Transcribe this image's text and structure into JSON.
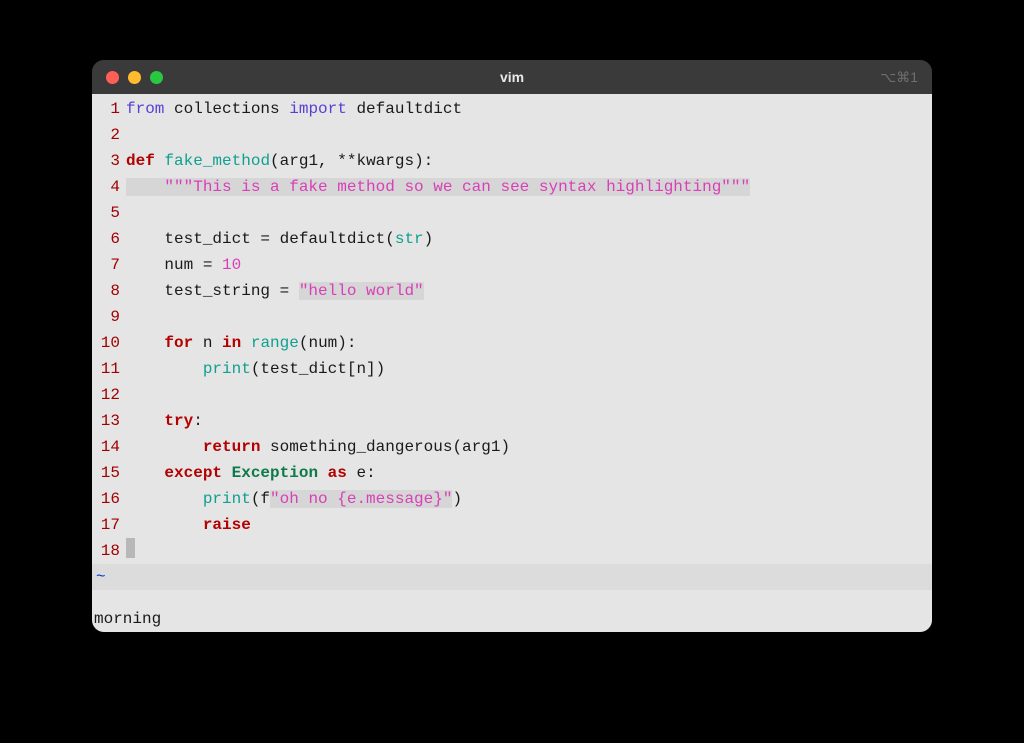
{
  "window": {
    "title": "vim",
    "shortcut": "⌥⌘1"
  },
  "traffic": {
    "red": "#ff5f57",
    "yellow": "#febc2e",
    "green": "#28c840"
  },
  "lines": [
    {
      "n": "1",
      "tokens": [
        [
          "keyword",
          "from"
        ],
        [
          "default",
          " collections "
        ],
        [
          "keyword",
          "import"
        ],
        [
          "default",
          " defaultdict"
        ]
      ]
    },
    {
      "n": "2",
      "tokens": []
    },
    {
      "n": "3",
      "tokens": [
        [
          "kw2",
          "def"
        ],
        [
          "default",
          " "
        ],
        [
          "func",
          "fake_method"
        ],
        [
          "default",
          "(arg1, **kwargs):"
        ]
      ]
    },
    {
      "n": "4",
      "tokens": [
        [
          "default",
          "    "
        ],
        [
          "string",
          "\"\"\"This is a fake method so we can see syntax highlighting\"\"\""
        ]
      ],
      "hlbg": true
    },
    {
      "n": "5",
      "tokens": []
    },
    {
      "n": "6",
      "tokens": [
        [
          "default",
          "    test_dict = defaultdict("
        ],
        [
          "type",
          "str"
        ],
        [
          "default",
          ")"
        ]
      ]
    },
    {
      "n": "7",
      "tokens": [
        [
          "default",
          "    num = "
        ],
        [
          "number",
          "10"
        ]
      ]
    },
    {
      "n": "8",
      "tokens": [
        [
          "default",
          "    test_string = "
        ],
        [
          "string",
          "\"hello world\""
        ]
      ],
      "hlbg_tokens": true
    },
    {
      "n": "9",
      "tokens": []
    },
    {
      "n": "10",
      "tokens": [
        [
          "default",
          "    "
        ],
        [
          "kw2",
          "for"
        ],
        [
          "default",
          " n "
        ],
        [
          "kw2",
          "in"
        ],
        [
          "default",
          " "
        ],
        [
          "builtin",
          "range"
        ],
        [
          "default",
          "(num):"
        ]
      ]
    },
    {
      "n": "11",
      "tokens": [
        [
          "default",
          "        "
        ],
        [
          "builtin",
          "print"
        ],
        [
          "default",
          "(test_dict[n])"
        ]
      ]
    },
    {
      "n": "12",
      "tokens": []
    },
    {
      "n": "13",
      "tokens": [
        [
          "default",
          "    "
        ],
        [
          "kw2",
          "try"
        ],
        [
          "default",
          ":"
        ]
      ]
    },
    {
      "n": "14",
      "tokens": [
        [
          "default",
          "        "
        ],
        [
          "kw2",
          "return"
        ],
        [
          "default",
          " something_dangerous(arg1)"
        ]
      ]
    },
    {
      "n": "15",
      "tokens": [
        [
          "default",
          "    "
        ],
        [
          "kw2",
          "except"
        ],
        [
          "default",
          " "
        ],
        [
          "exc",
          "Exception"
        ],
        [
          "default",
          " "
        ],
        [
          "kw2",
          "as"
        ],
        [
          "default",
          " e:"
        ]
      ]
    },
    {
      "n": "16",
      "tokens": [
        [
          "default",
          "        "
        ],
        [
          "builtin",
          "print"
        ],
        [
          "default",
          "(f"
        ],
        [
          "string",
          "\"oh no {e.message}\""
        ],
        [
          "default",
          ")"
        ]
      ],
      "hlbg_tokens": true
    },
    {
      "n": "17",
      "tokens": [
        [
          "default",
          "        "
        ],
        [
          "kw2",
          "raise"
        ]
      ]
    },
    {
      "n": "18",
      "tokens": [],
      "cursor": true
    }
  ],
  "tilde": "~",
  "status": "morning"
}
